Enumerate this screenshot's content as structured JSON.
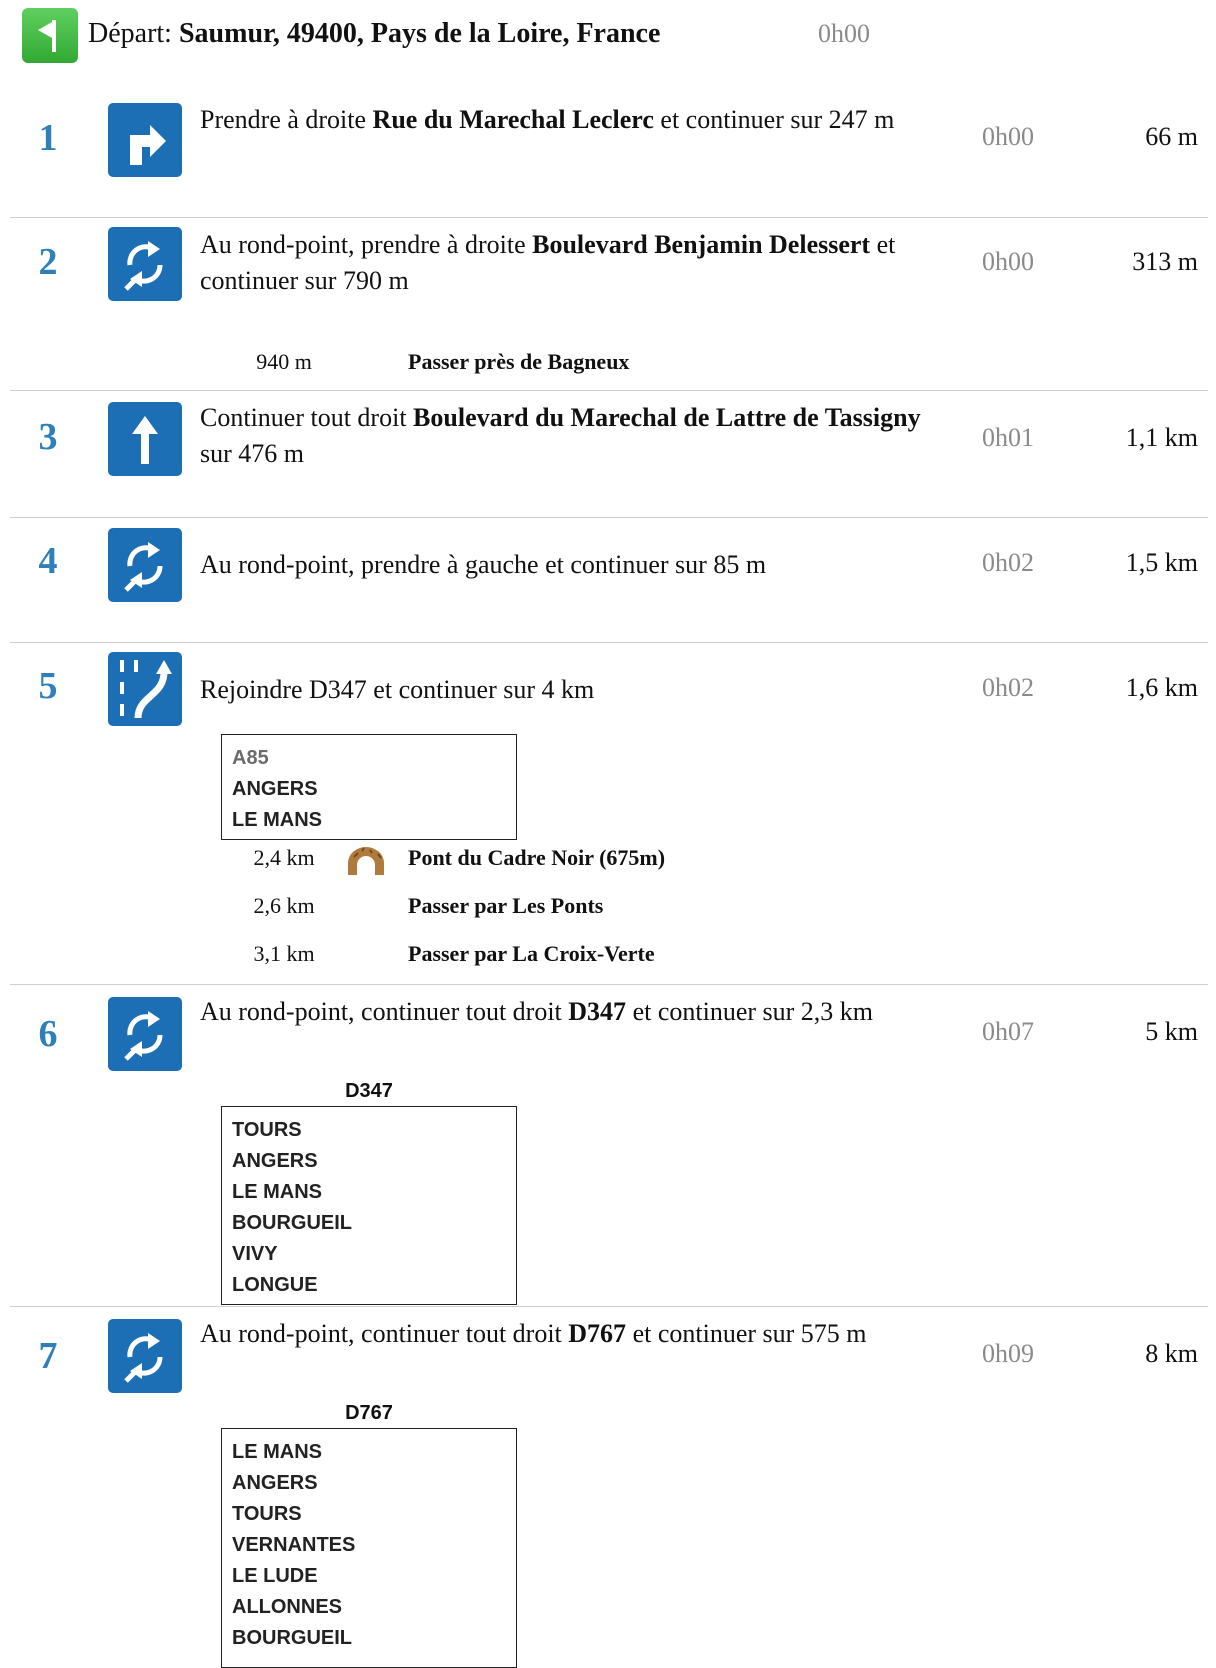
{
  "departure": {
    "label": "Départ:",
    "place": "Saumur, 49400, Pays de la Loire, France",
    "time": "0h00",
    "icon": "flag-icon",
    "color": "#3db83d"
  },
  "accent_color": "#2f7fb9",
  "icon_color": "#1c6eb5",
  "steps": [
    {
      "number": "1",
      "icon": "turn-right-icon",
      "pre": "Prendre à droite ",
      "road": "Rue du Marechal Leclerc",
      "post": " et continuer sur 247 m",
      "time": "0h00",
      "distance": "66 m"
    },
    {
      "number": "2",
      "icon": "roundabout-icon",
      "pre": "Au rond-point, prendre à droite ",
      "road": "Boulevard Benjamin Delessert",
      "post": " et continuer sur 790 m",
      "time": "0h00",
      "distance": "313 m",
      "waypoints": [
        {
          "distance": "940 m",
          "text": "Passer près de Bagneux"
        }
      ]
    },
    {
      "number": "3",
      "icon": "straight-ahead-icon",
      "pre": "Continuer tout droit ",
      "road": "Boulevard du Marechal de Lattre de Tassigny",
      "post": " sur 476 m",
      "time": "0h01",
      "distance": "1,1 km"
    },
    {
      "number": "4",
      "icon": "roundabout-icon",
      "pre": "Au rond-point, prendre à gauche et continuer sur 85 m",
      "road": "",
      "post": "",
      "time": "0h02",
      "distance": "1,5 km"
    },
    {
      "number": "5",
      "icon": "merge-icon",
      "pre": "Rejoindre D347 et continuer sur 4 km",
      "road": "",
      "post": "",
      "time": "0h02",
      "distance": "1,6 km",
      "sign": {
        "ref": "A85",
        "lines": [
          "ANGERS",
          "LE MANS"
        ]
      },
      "waypoints": [
        {
          "distance": "2,4 km",
          "icon": "tunnel-icon",
          "text": "Pont du Cadre Noir (675m)"
        },
        {
          "distance": "2,6 km",
          "text": "Passer par Les Ponts"
        },
        {
          "distance": "3,1 km",
          "text": "Passer par La Croix-Verte"
        }
      ]
    },
    {
      "number": "6",
      "icon": "roundabout-icon",
      "pre": "Au rond-point, continuer tout droit ",
      "road": "D347",
      "post": " et continuer sur 2,3 km",
      "time": "0h07",
      "distance": "5 km",
      "sign": {
        "road": "D347",
        "lines": [
          "TOURS",
          "ANGERS",
          "LE MANS",
          "BOURGUEIL",
          "VIVY",
          "LONGUE"
        ]
      }
    },
    {
      "number": "7",
      "icon": "roundabout-icon",
      "pre": "Au rond-point, continuer tout droit ",
      "road": "D767",
      "post": " et continuer sur 575 m",
      "time": "0h09",
      "distance": "8 km",
      "sign": {
        "road": "D767",
        "lines": [
          "LE MANS",
          "ANGERS",
          "TOURS",
          "VERNANTES",
          "LE LUDE",
          "ALLONNES",
          "BOURGUEIL"
        ]
      }
    }
  ]
}
